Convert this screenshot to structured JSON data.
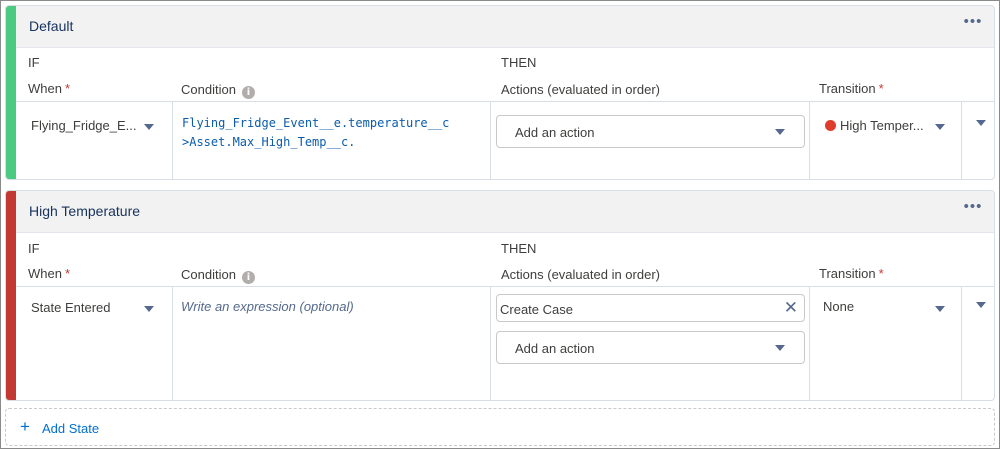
{
  "colors": {
    "default_accent": "#4bca81",
    "high_temp_accent": "#c23934",
    "link": "#0070d2",
    "state_dot": "#e03c2c"
  },
  "states": [
    {
      "title": "Default",
      "menu": "•••",
      "if_label": "IF",
      "then_label": "THEN",
      "headers": {
        "when": "When",
        "condition": "Condition",
        "actions": "Actions (evaluated in order)",
        "transition": "Transition",
        "required": "*",
        "info_icon": "i"
      },
      "when_value": "Flying_Fridge_E...",
      "condition_lines": [
        "Flying_Fridge_Event__e.temperature__c",
        ">Asset.Max_High_Temp__c."
      ],
      "add_action": "Add an action",
      "transition_value": "High Temper..."
    },
    {
      "title": "High Temperature",
      "menu": "•••",
      "if_label": "IF",
      "then_label": "THEN",
      "headers": {
        "when": "When",
        "condition": "Condition",
        "actions": "Actions (evaluated in order)",
        "transition": "Transition",
        "required": "*",
        "info_icon": "i"
      },
      "when_value": "State Entered",
      "condition_placeholder": "Write an expression (optional)",
      "action_item": "Create Case",
      "remove_icon": "✕",
      "add_action": "Add an action",
      "transition_value": "None"
    }
  ],
  "add_state": {
    "icon": "+",
    "label": "Add State"
  }
}
